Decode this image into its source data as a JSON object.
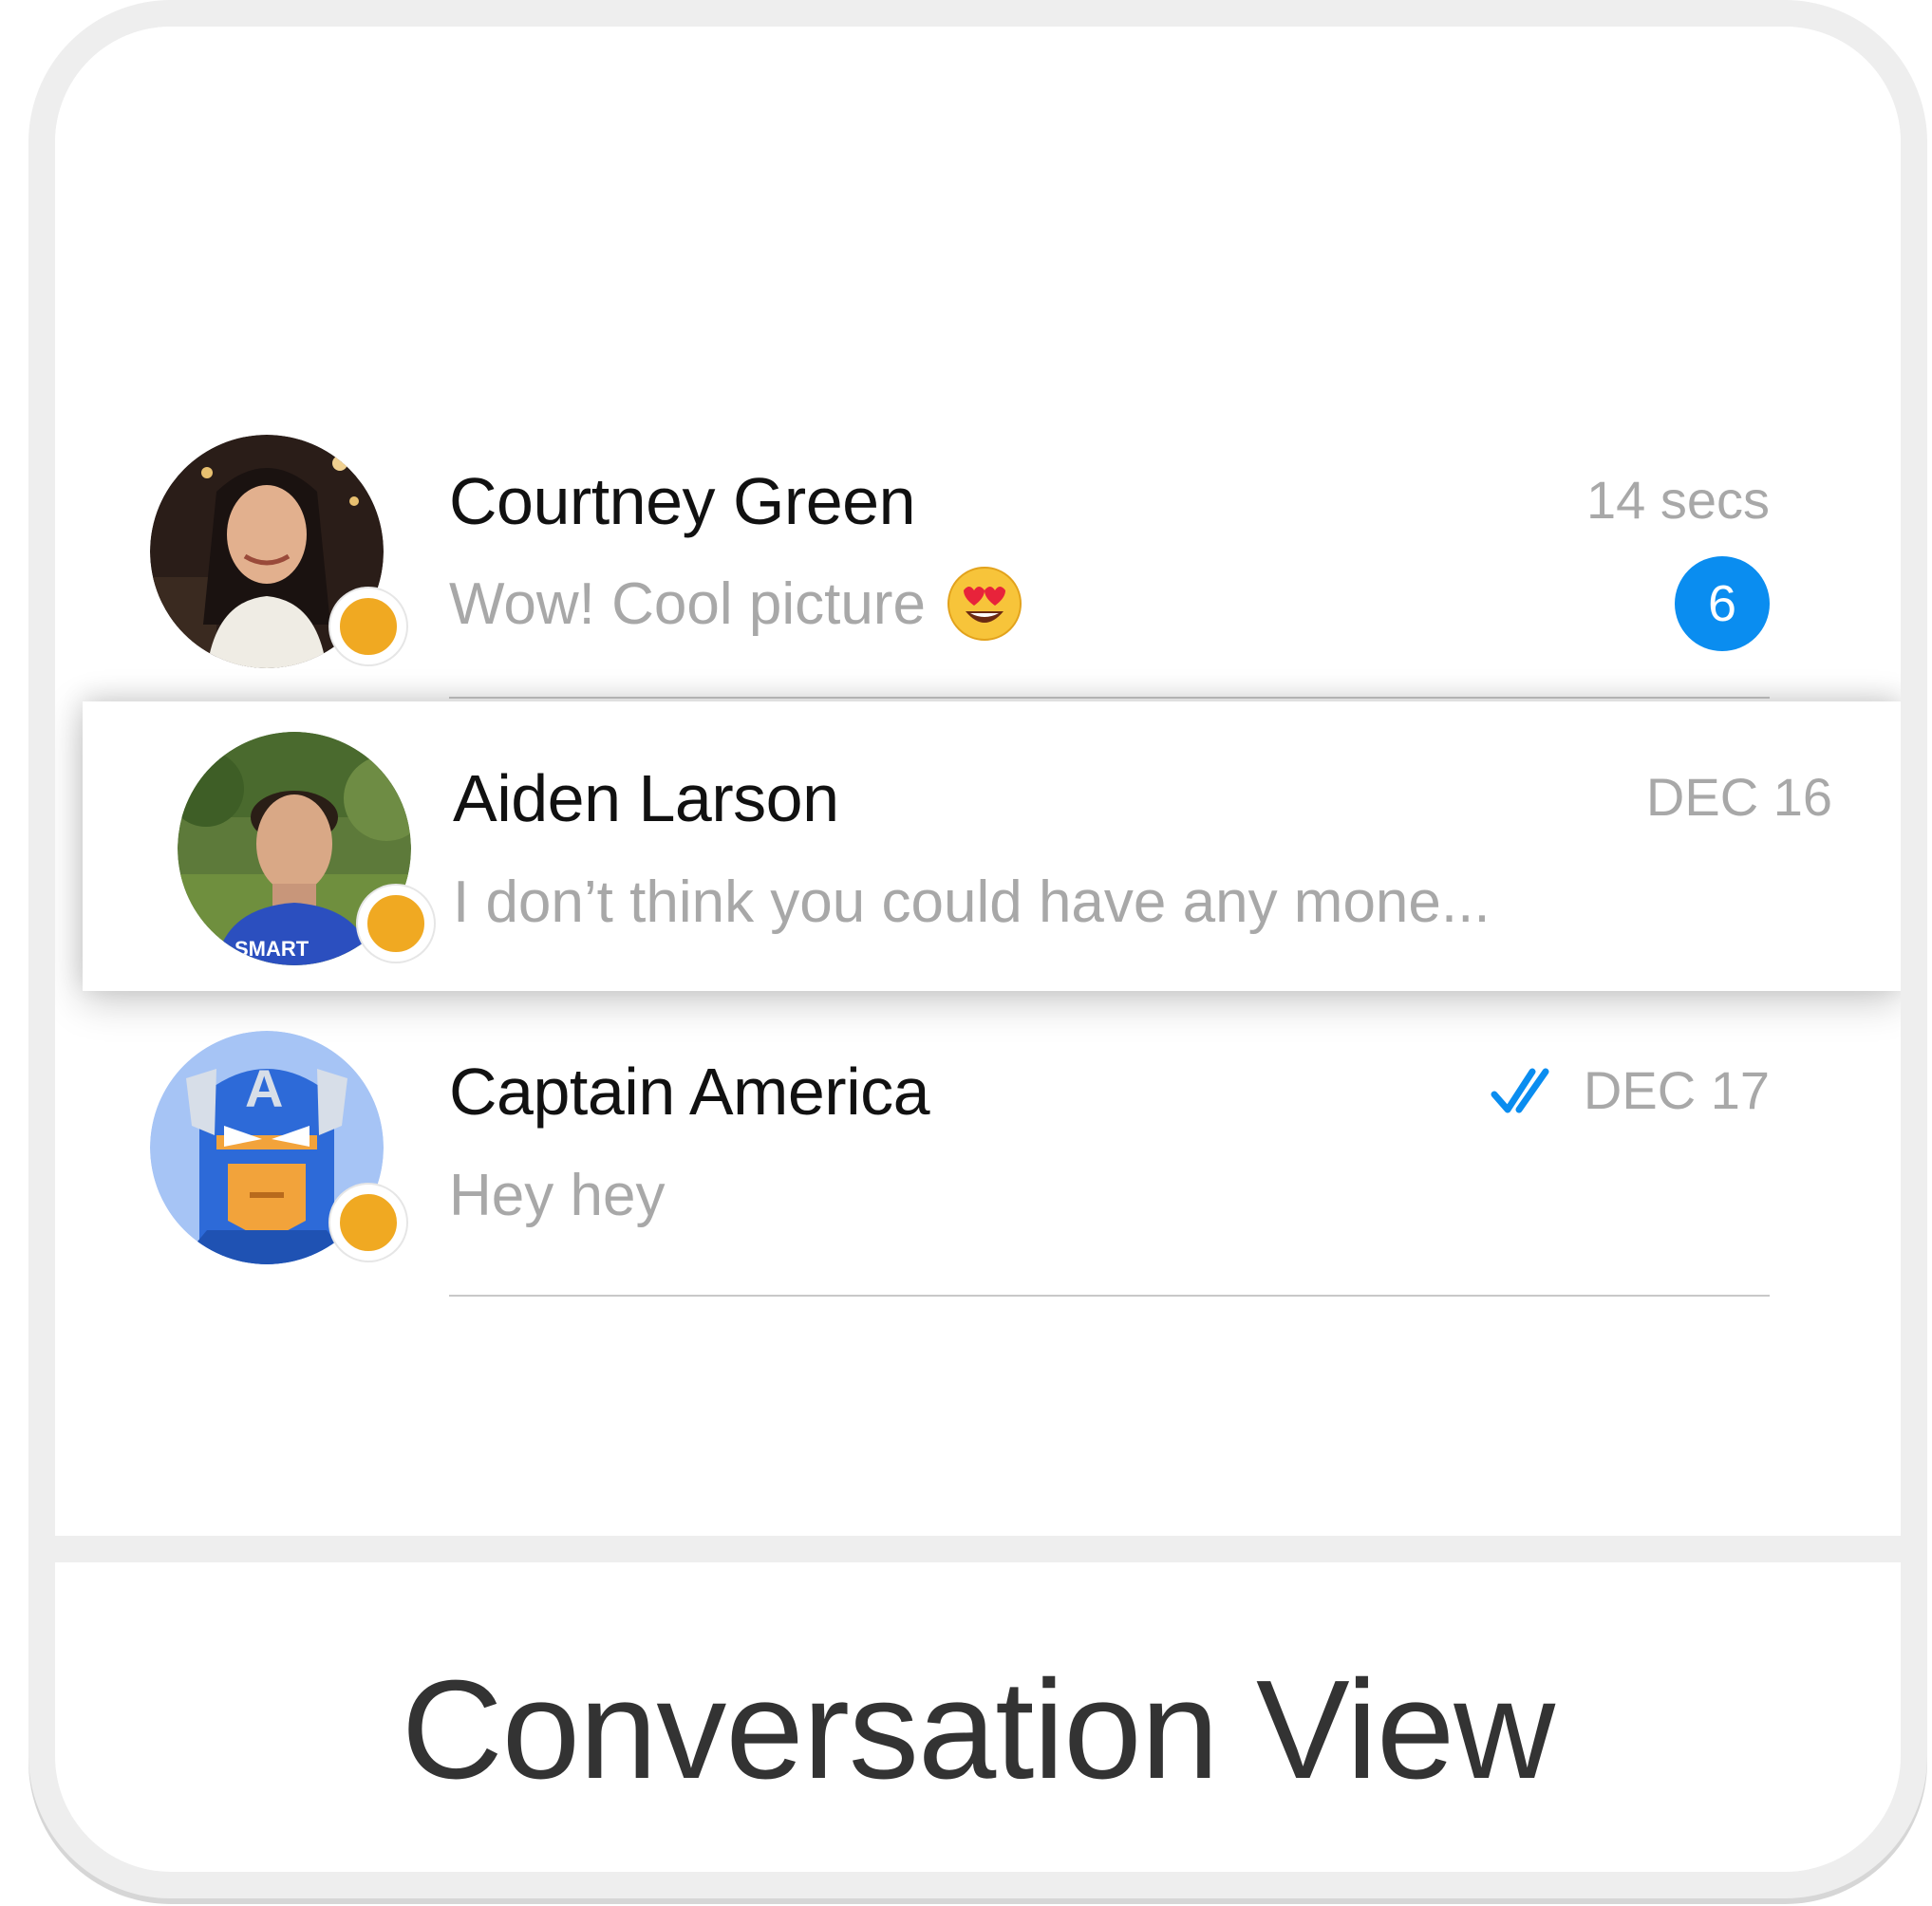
{
  "conversations": [
    {
      "name": "Courtney Green",
      "preview": "Wow! Cool picture",
      "preview_emoji": "heart-eyes-emoji",
      "time": "14 secs",
      "unread_count": "6",
      "status": "away",
      "avatar": "photo-avatar"
    },
    {
      "name": "Aiden Larson",
      "preview": "I don’t think you could have any mone...",
      "time": "DEC 16",
      "status": "away",
      "avatar": "photo-avatar",
      "highlighted": true
    },
    {
      "name": "Captain America",
      "preview": "Hey hey",
      "time": "DEC 17",
      "read_receipt": "double-check-icon",
      "status": "away",
      "avatar": "captain-america-avatar"
    }
  ],
  "caption": "Conversation View",
  "colors": {
    "status_away": "#f0a922",
    "badge": "#0a8df0",
    "read_check": "#0a8df0",
    "name_text": "#111111",
    "secondary_text": "#a8a8a8",
    "frame": "#eeeeee"
  }
}
